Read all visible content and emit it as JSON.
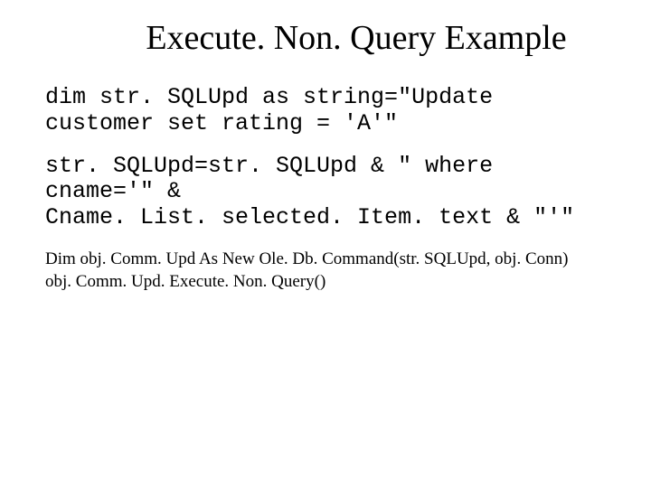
{
  "title": "Execute. Non. Query Example",
  "code1": "dim str. SQLUpd as string=\"Update customer set rating = 'A'\"",
  "code2": "str. SQLUpd=str. SQLUpd & \" where cname='\" &\nCname. List. selected. Item. text & \"'\"",
  "line1": "Dim obj. Comm. Upd As New Ole. Db. Command(str. SQLUpd, obj. Conn)",
  "line2": "obj. Comm. Upd. Execute. Non. Query()"
}
